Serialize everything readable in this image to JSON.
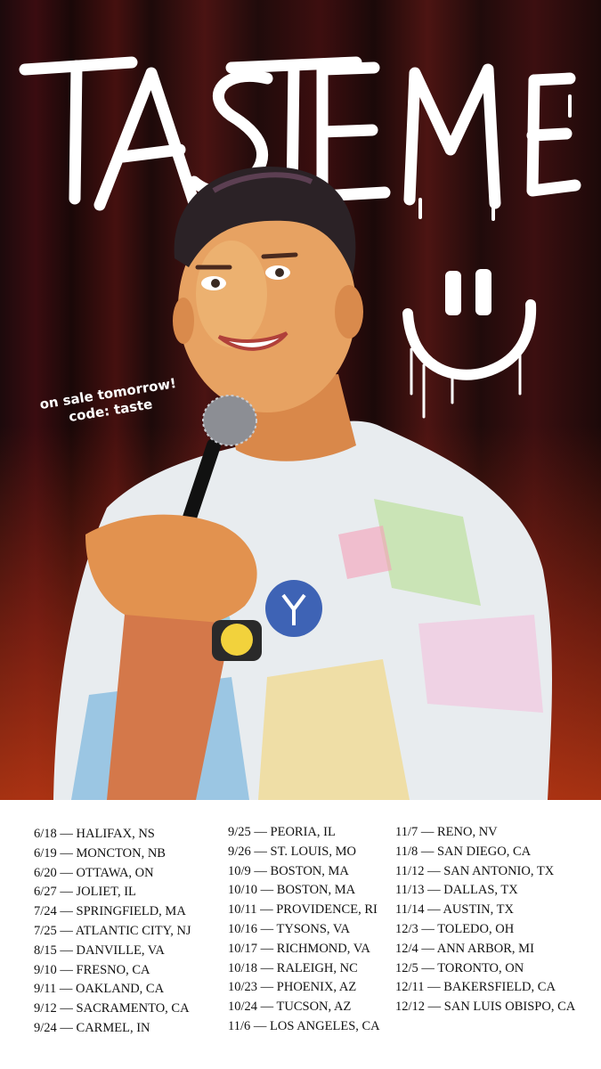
{
  "poster": {
    "title": "TASTE ME",
    "promo_line1": "on sale tomorrow!",
    "promo_line2": "code: taste"
  },
  "tour_dates": {
    "column1": [
      "6/18 — HALIFAX, NS",
      "6/19 — MONCTON, NB",
      "6/20 — OTTAWA, ON",
      "6/27 — JOLIET, IL",
      "7/24 — SPRINGFIELD, MA",
      "7/25 — ATLANTIC CITY, NJ",
      "8/15 — DANVILLE, VA",
      "9/10 — FRESNO, CA",
      "9/11 — OAKLAND, CA",
      "9/12 — SACRAMENTO, CA",
      "9/24 — CARMEL, IN"
    ],
    "column2": [
      "9/25 — PEORIA, IL",
      "9/26 — ST. LOUIS, MO",
      "10/9 — BOSTON, MA",
      "10/10 — BOSTON, MA",
      "10/11 — PROVIDENCE, RI",
      "10/16 — TYSONS, VA",
      "10/17 — RICHMOND, VA",
      "10/18 — RALEIGH, NC",
      "10/23 — PHOENIX, AZ",
      "10/24 — TUCSON, AZ",
      "11/6 — LOS ANGELES, CA"
    ],
    "column3": [
      "11/7 — RENO, NV",
      "11/8 — SAN DIEGO, CA",
      "11/12 — SAN ANTONIO, TX",
      "11/13 — DALLAS, TX",
      "11/14 — AUSTIN, TX",
      "12/3 — TOLEDO, OH",
      "12/4 — ANN ARBOR, MI",
      "12/5 — TORONTO, ON",
      "12/11 — BAKERSFIELD, CA",
      "12/12 — SAN LUIS OBISPO, CA"
    ]
  },
  "colors": {
    "background": "#2a0c0e",
    "accent_red": "#b8321a",
    "text": "#111111",
    "title_paint": "#ffffff"
  }
}
